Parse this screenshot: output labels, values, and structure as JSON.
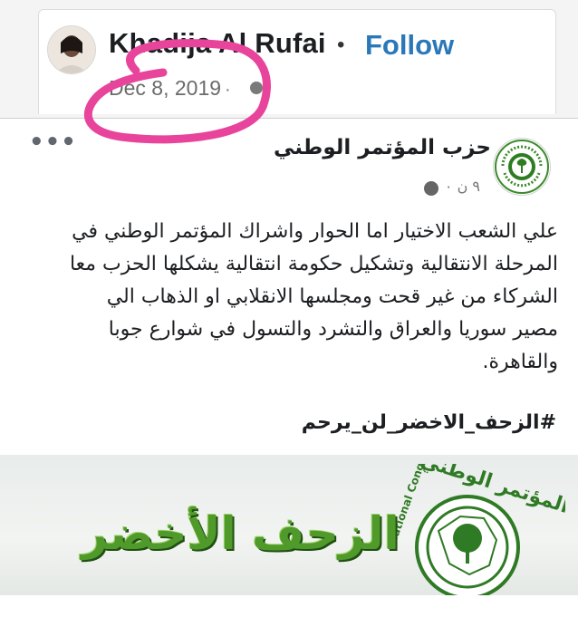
{
  "outer_post": {
    "author": "Khadija Al Rufai",
    "separator": "•",
    "follow_label": "Follow",
    "date": "Dec 8, 2019",
    "date_separator": "·"
  },
  "annotation": {
    "color": "#e8449c"
  },
  "inner_post": {
    "more_label": "•••",
    "page_name": "حزب المؤتمر الوطني",
    "meta": "٩ ن ٠",
    "body_lines": [
      "علي الشعب الاختيار اما الحوار واشراك  المؤتمر الوطني في",
      "المرحلة الانتقالية وتشكيل حكومة انتقالية يشكلها الحزب معا",
      "الشركاء من غير قحت ومجلسها الانقلابي او الذهاب الي",
      "مصير سوريا والعراق والتشرد والتسول في شوارع جوبا",
      "والقاهرة."
    ],
    "hashtag": "#الزحف_الاخضر_لن_يرحم"
  },
  "banner": {
    "slogan": "الزحف الأخضر",
    "emblem_arabic": "المؤتمر الوطني",
    "emblem_english": "National Congress",
    "brand_green": "#4f9a2a"
  },
  "icons": {
    "avatar": "avatar-photo",
    "date_privacy": "globe-icon",
    "page_logo": "national-congress-logo",
    "meta_privacy": "globe-icon",
    "more": "more-options-icon"
  }
}
